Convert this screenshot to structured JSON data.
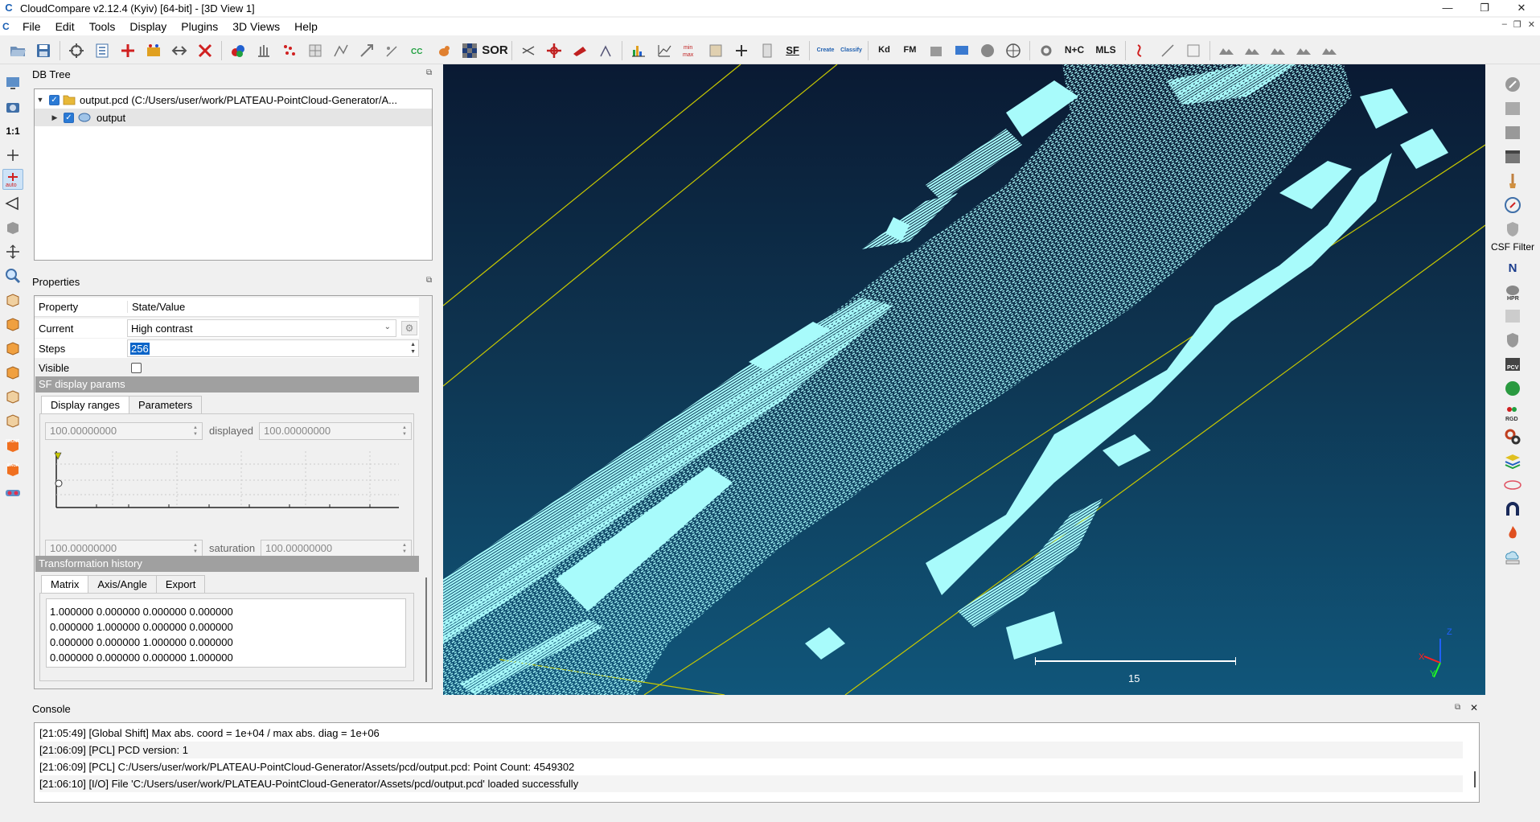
{
  "window": {
    "title": "CloudCompare v2.12.4 (Kyiv) [64-bit] - [3D View 1]",
    "app_icon": "cloudcompare-logo-icon",
    "controls": [
      "—",
      "❐",
      "✕"
    ]
  },
  "menubar": {
    "items": [
      "File",
      "Edit",
      "Tools",
      "Display",
      "Plugins",
      "3D Views",
      "Help"
    ],
    "mdi_controls": [
      "–",
      "❐",
      "✕"
    ]
  },
  "toolbar": {
    "sor_label": "SOR",
    "sf_label": "SF",
    "kd_label": "Kd",
    "fm_label": "FM",
    "nc_label": "N+C",
    "mls_label": "MLS",
    "create_label": "Create",
    "classify_label": "Classify"
  },
  "lefttoolbar": {
    "one_to_one": "1:1",
    "auto_label": "auto",
    "front_label": "FRONT",
    "back_label": "BACK"
  },
  "righttoolbar": {
    "csf_label": "CSF Filter",
    "n_label": "N",
    "hpr_label": "HPR",
    "pcv_label": "PCV",
    "rgd_label": "RGD"
  },
  "dbtree": {
    "title": "DB Tree",
    "float_icon": "⧉",
    "root": "output.pcd (C:/Users/user/work/PLATEAU-PointCloud-Generator/A...",
    "child": "output"
  },
  "properties": {
    "title": "Properties",
    "float_icon": "⧉",
    "header_property": "Property",
    "header_value": "State/Value",
    "current_label": "Current",
    "current_value": "High contrast",
    "steps_label": "Steps",
    "steps_value": "256",
    "visible_label": "Visible",
    "sf_section": "SF display params",
    "tab_display_ranges": "Display ranges",
    "tab_parameters": "Parameters",
    "range_min": "100.00000000",
    "displayed_label": "displayed",
    "displayed_value": "100.00000000",
    "sat_min": "100.00000000",
    "saturation_label": "saturation",
    "saturation_value": "100.00000000",
    "transform_section": "Transformation history",
    "tab_matrix": "Matrix",
    "tab_axis": "Axis/Angle",
    "tab_export": "Export",
    "matrix": [
      "1.000000 0.000000 0.000000 0.000000",
      "0.000000 1.000000 0.000000 0.000000",
      "0.000000 0.000000 1.000000 0.000000",
      "0.000000 0.000000 0.000000 1.000000"
    ]
  },
  "view3d": {
    "scale_label": "15",
    "axis_x": "X",
    "axis_y": "Y",
    "axis_z": "Z",
    "point_color": "#a8fbfb",
    "bbox_color": "#c8c800"
  },
  "console": {
    "title": "Console",
    "lines": [
      "[21:05:49] [Global Shift] Max abs. coord = 1e+04 / max abs. diag = 1e+06",
      "[21:06:09] [PCL] PCD version: 1",
      "[21:06:09] [PCL] C:/Users/user/work/PLATEAU-PointCloud-Generator/Assets/pcd/output.pcd: Point Count: 4549302",
      "[21:06:10] [I/O] File 'C:/Users/user/work/PLATEAU-PointCloud-Generator/Assets/pcd/output.pcd' loaded successfully"
    ],
    "float_icon": "⧉",
    "close_icon": "✕"
  }
}
